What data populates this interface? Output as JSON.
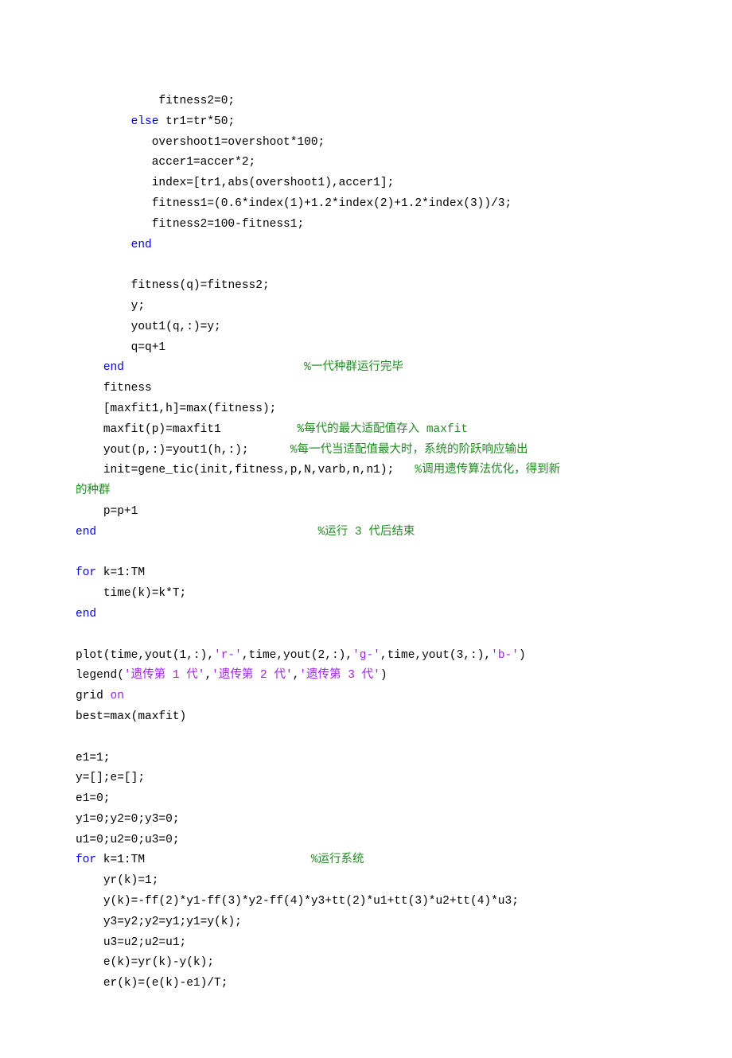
{
  "lines": [
    {
      "indent": "            ",
      "segs": [
        {
          "t": "fitness2=0;",
          "c": ""
        }
      ]
    },
    {
      "indent": "        ",
      "segs": [
        {
          "t": "else",
          "c": "kw"
        },
        {
          "t": " tr1=tr*50;",
          "c": ""
        }
      ]
    },
    {
      "indent": "           ",
      "segs": [
        {
          "t": "overshoot1=overshoot*100;",
          "c": ""
        }
      ]
    },
    {
      "indent": "           ",
      "segs": [
        {
          "t": "accer1=accer*2;",
          "c": ""
        }
      ]
    },
    {
      "indent": "           ",
      "segs": [
        {
          "t": "index=[tr1,abs(overshoot1),accer1];",
          "c": ""
        }
      ]
    },
    {
      "indent": "           ",
      "segs": [
        {
          "t": "fitness1=(0.6*index(1)+1.2*index(2)+1.2*index(3))/3;",
          "c": ""
        }
      ]
    },
    {
      "indent": "           ",
      "segs": [
        {
          "t": "fitness2=100-fitness1;",
          "c": ""
        }
      ]
    },
    {
      "indent": "        ",
      "segs": [
        {
          "t": "end",
          "c": "kw"
        }
      ]
    },
    {
      "indent": "",
      "segs": [
        {
          "t": "",
          "c": ""
        }
      ]
    },
    {
      "indent": "        ",
      "segs": [
        {
          "t": "fitness(q)=fitness2;",
          "c": ""
        }
      ]
    },
    {
      "indent": "        ",
      "segs": [
        {
          "t": "y;",
          "c": ""
        }
      ]
    },
    {
      "indent": "        ",
      "segs": [
        {
          "t": "yout1(q,:)=y;",
          "c": ""
        }
      ]
    },
    {
      "indent": "        ",
      "segs": [
        {
          "t": "q=q+1",
          "c": ""
        }
      ]
    },
    {
      "indent": "    ",
      "segs": [
        {
          "t": "end",
          "c": "kw"
        },
        {
          "t": "                          ",
          "c": ""
        },
        {
          "t": "%一代种群运行完毕",
          "c": "cm"
        }
      ]
    },
    {
      "indent": "    ",
      "segs": [
        {
          "t": "fitness",
          "c": ""
        }
      ]
    },
    {
      "indent": "    ",
      "segs": [
        {
          "t": "[maxfit1,h]=max(fitness);",
          "c": ""
        }
      ]
    },
    {
      "indent": "    ",
      "segs": [
        {
          "t": "maxfit(p)=maxfit1           ",
          "c": ""
        },
        {
          "t": "%每代的最大适配值存入 maxfit",
          "c": "cm"
        }
      ]
    },
    {
      "indent": "    ",
      "segs": [
        {
          "t": "yout(p,:)=yout1(h,:);      ",
          "c": ""
        },
        {
          "t": "%每一代当适配值最大时，系统的阶跃响应输出",
          "c": "cm"
        }
      ]
    },
    {
      "indent": "    ",
      "segs": [
        {
          "t": "init=gene_tic(init,fitness,p,N,varb,n,n1);   ",
          "c": ""
        },
        {
          "t": "%调用遗传算法优化，得到新",
          "c": "cm"
        }
      ]
    },
    {
      "indent": "",
      "segs": [
        {
          "t": "的种群",
          "c": "cm"
        }
      ]
    },
    {
      "indent": "    ",
      "segs": [
        {
          "t": "p=p+1",
          "c": ""
        }
      ]
    },
    {
      "indent": "",
      "segs": [
        {
          "t": "end",
          "c": "kw"
        },
        {
          "t": "                                ",
          "c": ""
        },
        {
          "t": "%运行 3 代后结束",
          "c": "cm"
        }
      ]
    },
    {
      "indent": "",
      "segs": [
        {
          "t": "",
          "c": ""
        }
      ]
    },
    {
      "indent": "",
      "segs": [
        {
          "t": "for",
          "c": "kw"
        },
        {
          "t": " k=1:TM",
          "c": ""
        }
      ]
    },
    {
      "indent": "    ",
      "segs": [
        {
          "t": "time(k)=k*T;",
          "c": ""
        }
      ]
    },
    {
      "indent": "",
      "segs": [
        {
          "t": "end",
          "c": "kw"
        }
      ]
    },
    {
      "indent": "",
      "segs": [
        {
          "t": "",
          "c": ""
        }
      ]
    },
    {
      "indent": "",
      "segs": [
        {
          "t": "plot(time,yout(1,:),",
          "c": ""
        },
        {
          "t": "'r-'",
          "c": "st"
        },
        {
          "t": ",time,yout(2,:),",
          "c": ""
        },
        {
          "t": "'g-'",
          "c": "st"
        },
        {
          "t": ",time,yout(3,:),",
          "c": ""
        },
        {
          "t": "'b-'",
          "c": "st"
        },
        {
          "t": ")",
          "c": ""
        }
      ]
    },
    {
      "indent": "",
      "segs": [
        {
          "t": "legend(",
          "c": ""
        },
        {
          "t": "'遗传第 1 代'",
          "c": "st"
        },
        {
          "t": ",",
          "c": ""
        },
        {
          "t": "'遗传第 2 代'",
          "c": "st"
        },
        {
          "t": ",",
          "c": ""
        },
        {
          "t": "'遗传第 3 代'",
          "c": "st"
        },
        {
          "t": ")",
          "c": ""
        }
      ]
    },
    {
      "indent": "",
      "segs": [
        {
          "t": "grid ",
          "c": ""
        },
        {
          "t": "on",
          "c": "st"
        }
      ]
    },
    {
      "indent": "",
      "segs": [
        {
          "t": "best=max(maxfit)",
          "c": ""
        }
      ]
    },
    {
      "indent": "",
      "segs": [
        {
          "t": "",
          "c": ""
        }
      ]
    },
    {
      "indent": "",
      "segs": [
        {
          "t": "e1=1;",
          "c": ""
        }
      ]
    },
    {
      "indent": "",
      "segs": [
        {
          "t": "y=[];e=[];",
          "c": ""
        }
      ]
    },
    {
      "indent": "",
      "segs": [
        {
          "t": "e1=0;",
          "c": ""
        }
      ]
    },
    {
      "indent": "",
      "segs": [
        {
          "t": "y1=0;y2=0;y3=0;",
          "c": ""
        }
      ]
    },
    {
      "indent": "",
      "segs": [
        {
          "t": "u1=0;u2=0;u3=0;",
          "c": ""
        }
      ]
    },
    {
      "indent": "",
      "segs": [
        {
          "t": "for",
          "c": "kw"
        },
        {
          "t": " k=1:TM                        ",
          "c": ""
        },
        {
          "t": "%运行系统",
          "c": "cm"
        }
      ]
    },
    {
      "indent": "    ",
      "segs": [
        {
          "t": "yr(k)=1;",
          "c": ""
        }
      ]
    },
    {
      "indent": "    ",
      "segs": [
        {
          "t": "y(k)=-ff(2)*y1-ff(3)*y2-ff(4)*y3+tt(2)*u1+tt(3)*u2+tt(4)*u3;",
          "c": ""
        }
      ]
    },
    {
      "indent": "    ",
      "segs": [
        {
          "t": "y3=y2;y2=y1;y1=y(k);",
          "c": ""
        }
      ]
    },
    {
      "indent": "    ",
      "segs": [
        {
          "t": "u3=u2;u2=u1;",
          "c": ""
        }
      ]
    },
    {
      "indent": "    ",
      "segs": [
        {
          "t": "e(k)=yr(k)-y(k);",
          "c": ""
        }
      ]
    },
    {
      "indent": "    ",
      "segs": [
        {
          "t": "er(k)=(e(k)-e1)/T;",
          "c": ""
        }
      ]
    }
  ]
}
